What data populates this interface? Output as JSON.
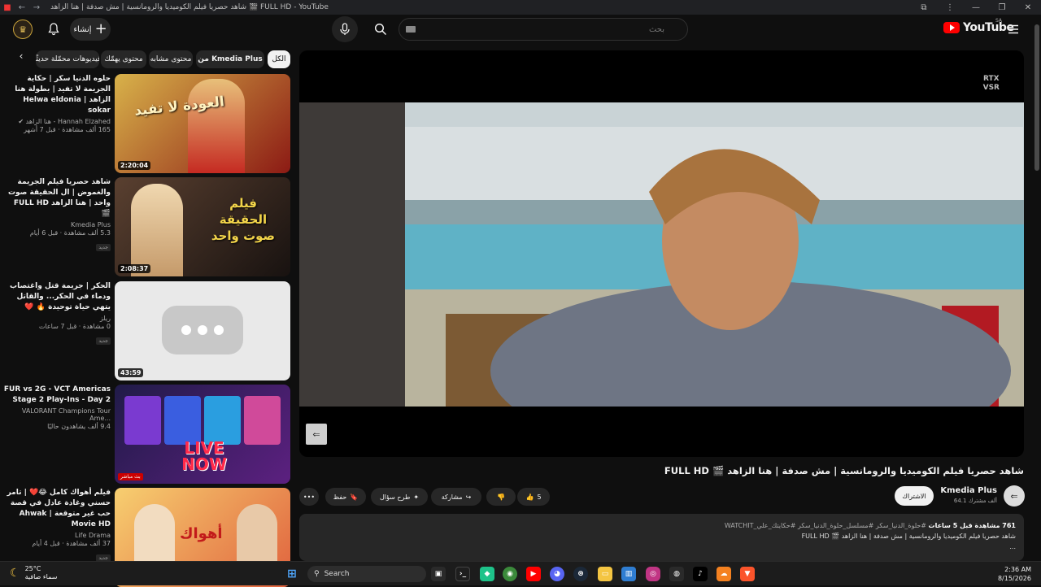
{
  "browser": {
    "tab_title": "شاهد حصريا فيلم الكوميديا والرومانسية | مش صدفة | هنا الزاهد 🎬 FULL HD - YouTube"
  },
  "header": {
    "create_label": "إنشاء",
    "search_placeholder": "بحث",
    "logo_text": "YouTube",
    "logo_region": "SA"
  },
  "chips": [
    {
      "label": "الكل",
      "active": true
    },
    {
      "label": "من Kmedia Plus",
      "active": false
    },
    {
      "label": "محتوى مشابه",
      "active": false
    },
    {
      "label": "محتوى يهمّك",
      "active": false
    },
    {
      "label": "فيديوهات محمّلة حديثًا",
      "active": false
    }
  ],
  "recommended": [
    {
      "title": "حلوه الدنيا سكر | حكاية الجريمة لا تفيد | بطولة هنا الزاهد | Helwa eldonia sokar",
      "channel": "Hannah Elzahed - هنا الزاهد ✔",
      "stats": "165 ألف مشاهدة · قبل 7 أشهر",
      "duration": "2:20:04",
      "badge": ""
    },
    {
      "title": "شاهد حصريا فيلم الجريمة والغموض | ال الحقيقة صوت واحد | هنا الزاهد FULL HD 🎬",
      "channel": "Kmedia Plus",
      "stats": "5.3 ألف مشاهدة · قبل 6 أيام",
      "duration": "2:08:37",
      "badge": "جديد"
    },
    {
      "title": "الحكر | جريمة قتل واغتصاب ودماء في الحكر... والقاتل يتهي حياة توحيدة 🔥 ❤️",
      "channel": "ريلز",
      "stats": "0 مشاهدة · قبل 7 ساعات",
      "duration": "43:59",
      "badge": "جديد"
    },
    {
      "title": "FUR vs 2G - VCT Americas Stage 2 Play-Ins - Day 2",
      "channel": "VALORANT Champions Tour Ame...",
      "stats": "9.4 ألف يشاهدون حاليًا",
      "duration": "",
      "badge": "بث مباشر"
    },
    {
      "title": "فيلم أهواك كامل 😂❤️ | تامر حسني وغادة عادل في قصة حب غير متوقعة | Ahwak Movie HD",
      "channel": "Life Drama",
      "stats": "37 ألف مشاهدة · قبل 4 أيام",
      "duration": "",
      "badge": "جديد"
    }
  ],
  "thumbs": [
    {
      "text": "العودة لا تفيد",
      "colors": [
        "#d8b24a",
        "#b22a1e"
      ]
    },
    {
      "text": "فيلم الحقيقة صوت واحد",
      "colors": [
        "#4a3728",
        "#1c1410"
      ]
    },
    {
      "text": "",
      "colors": [
        "#e9e9e9",
        "#e9e9e9"
      ]
    },
    {
      "text": "LIVE NOW",
      "colors": [
        "#1f1a46",
        "#5a1f7a"
      ]
    },
    {
      "text": "أهواك",
      "colors": [
        "#f7c86a",
        "#e2633f"
      ]
    }
  ],
  "player": {
    "rtx_line1": "RTX",
    "rtx_line2": "VSR"
  },
  "video": {
    "title": "شاهد حصريا فيلم الكوميديا والرومانسية | مش صدفة | هنا الزاهد 🎬 FULL HD",
    "channel_name": "Kmedia Plus",
    "channel_subs": "64.1 ألف مشترك",
    "subscribe_label": "الاشتراك",
    "likes": "5",
    "share_label": "مشاركة",
    "ask_label": "طرح سؤال",
    "save_label": "حفظ",
    "more_label": "•••",
    "description_stats": "761 مشاهدة  قبل 5 ساعات",
    "description_tags": "#حلوة_الدنيا_سكر #مسلسل_حلوة_الدنيا_سكر #حكايتك_علي_WATCHIT",
    "description_line2": "شاهد حصريا فيلم الكوميديا والرومانسية | مش صدفة | هنا الزاهد 🎬 FULL HD",
    "description_line3": "..."
  },
  "taskbar": {
    "weather_temp": "25°C",
    "weather_text": "سماء صافية",
    "search_label": "Search",
    "time": "2:36 AM",
    "date": "8/15/2026"
  }
}
